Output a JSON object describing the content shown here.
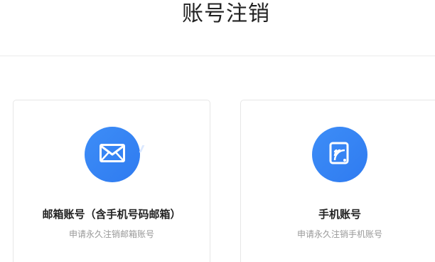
{
  "page": {
    "title": "账号注销"
  },
  "options": [
    {
      "title": "邮箱账号（含手机号码邮箱）",
      "subtitle": "申请永久注销邮箱账号",
      "icon": "envelope-icon"
    },
    {
      "title": "手机账号",
      "subtitle": "申请永久注销手机账号",
      "icon": "phone-signal-icon"
    }
  ],
  "colors": {
    "accent": "#2f7bf0",
    "title_text": "#222222",
    "sub_text": "#999999",
    "border": "#e6e6e6"
  }
}
